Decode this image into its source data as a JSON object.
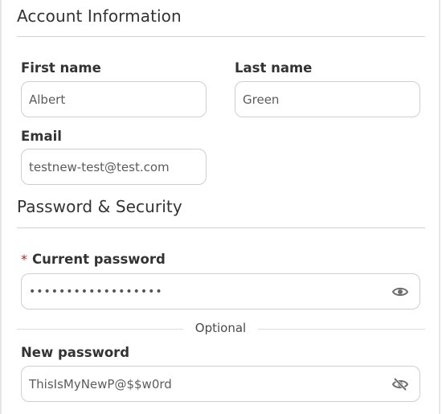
{
  "account": {
    "title": "Account Information",
    "first_name": {
      "label": "First name",
      "value": "Albert"
    },
    "last_name": {
      "label": "Last name",
      "value": "Green"
    },
    "email": {
      "label": "Email",
      "value": "testnew-test@test.com"
    }
  },
  "security": {
    "title": "Password & Security",
    "current_password": {
      "required_mark": "*",
      "label": "Current password",
      "value": "••••••••••••••••••",
      "toggle_icon": "eye-icon"
    },
    "separator_label": "Optional",
    "new_password": {
      "label": "New password",
      "value": "ThisIsMyNewP@$$w0rd",
      "toggle_icon": "eye-off-icon"
    }
  },
  "colors": {
    "required": "#b3261e",
    "border": "#cfcfcf",
    "text": "#333333"
  }
}
